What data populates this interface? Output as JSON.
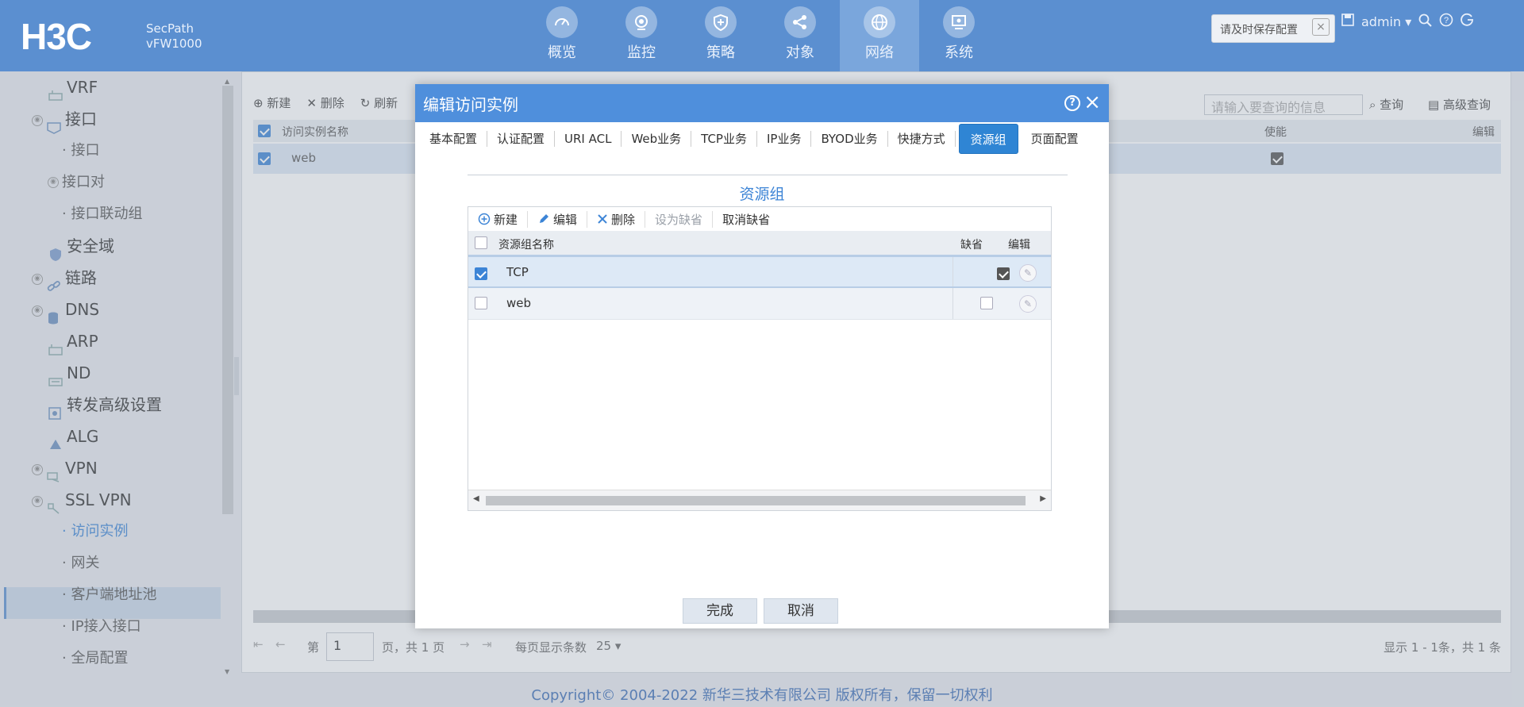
{
  "brand": {
    "logo_text": "H3C",
    "product_line1": "SecPath",
    "product_line2": "vFW1000"
  },
  "nav": [
    {
      "label": "概览",
      "icon": "dashboard-icon"
    },
    {
      "label": "监控",
      "icon": "monitor-icon"
    },
    {
      "label": "策略",
      "icon": "shield-plus-icon"
    },
    {
      "label": "对象",
      "icon": "share-nodes-icon"
    },
    {
      "label": "网络",
      "icon": "globe-icon",
      "active": true
    },
    {
      "label": "系统",
      "icon": "system-screen-icon"
    }
  ],
  "header": {
    "save_tip": "请及时保存配置",
    "save_tip_close": "×",
    "user": "admin"
  },
  "sidebar": {
    "items": [
      {
        "label": "VRF"
      },
      {
        "label": "接口"
      },
      {
        "label": "接口"
      },
      {
        "label": "接口对"
      },
      {
        "label": "接口联动组"
      },
      {
        "label": "安全域"
      },
      {
        "label": "链路"
      },
      {
        "label": "DNS"
      },
      {
        "label": "ARP"
      },
      {
        "label": "ND"
      },
      {
        "label": "转发高级设置"
      },
      {
        "label": "ALG"
      },
      {
        "label": "VPN"
      },
      {
        "label": "SSL VPN"
      },
      {
        "label": "访问实例"
      },
      {
        "label": "网关"
      },
      {
        "label": "客户端地址池"
      },
      {
        "label": "IP接入接口"
      },
      {
        "label": "全局配置"
      }
    ]
  },
  "main": {
    "toolbar": {
      "new": "新建",
      "delete": "删除",
      "refresh": "刷新"
    },
    "search_placeholder": "请输入要查询的信息",
    "search_btn": "查询",
    "adv_search_btn": "高级查询",
    "columns": {
      "name": "访问实例名称",
      "enable": "使能",
      "edit": "编辑"
    },
    "rows": [
      {
        "name": "web"
      }
    ],
    "pager": {
      "prefix": "第",
      "page": "1",
      "suffix": "页，共 1 页",
      "per_page_label": "每页显示条数",
      "per_page": "25",
      "summary": "显示 1 - 1条，共 1 条"
    }
  },
  "dialog": {
    "title": "编辑访问实例",
    "help": "?",
    "close": "×",
    "tabs": [
      "基本配置",
      "认证配置",
      "URI ACL",
      "Web业务",
      "TCP业务",
      "IP业务",
      "BYOD业务",
      "快捷方式",
      "资源组",
      "页面配置"
    ],
    "active_tab": "资源组",
    "section_title": "资源组",
    "toolbar": {
      "new": "新建",
      "edit": "编辑",
      "delete": "删除",
      "set_default": "设为缺省",
      "cancel_default": "取消缺省"
    },
    "columns": {
      "name": "资源组名称",
      "default": "缺省",
      "edit": "编辑"
    },
    "rows": [
      {
        "name": "TCP",
        "selected": true,
        "default": true
      },
      {
        "name": "web",
        "selected": false,
        "default": false
      }
    ],
    "ok": "完成",
    "cancel": "取消"
  },
  "footer": {
    "copyright": "Copyright© 2004-2022 新华三技术有限公司 版权所有，保留一切权利"
  },
  "colors": {
    "header_bg": "#5b8fd0",
    "dialog_title_bg": "#4f8fdc",
    "accent": "#3c84d6"
  }
}
